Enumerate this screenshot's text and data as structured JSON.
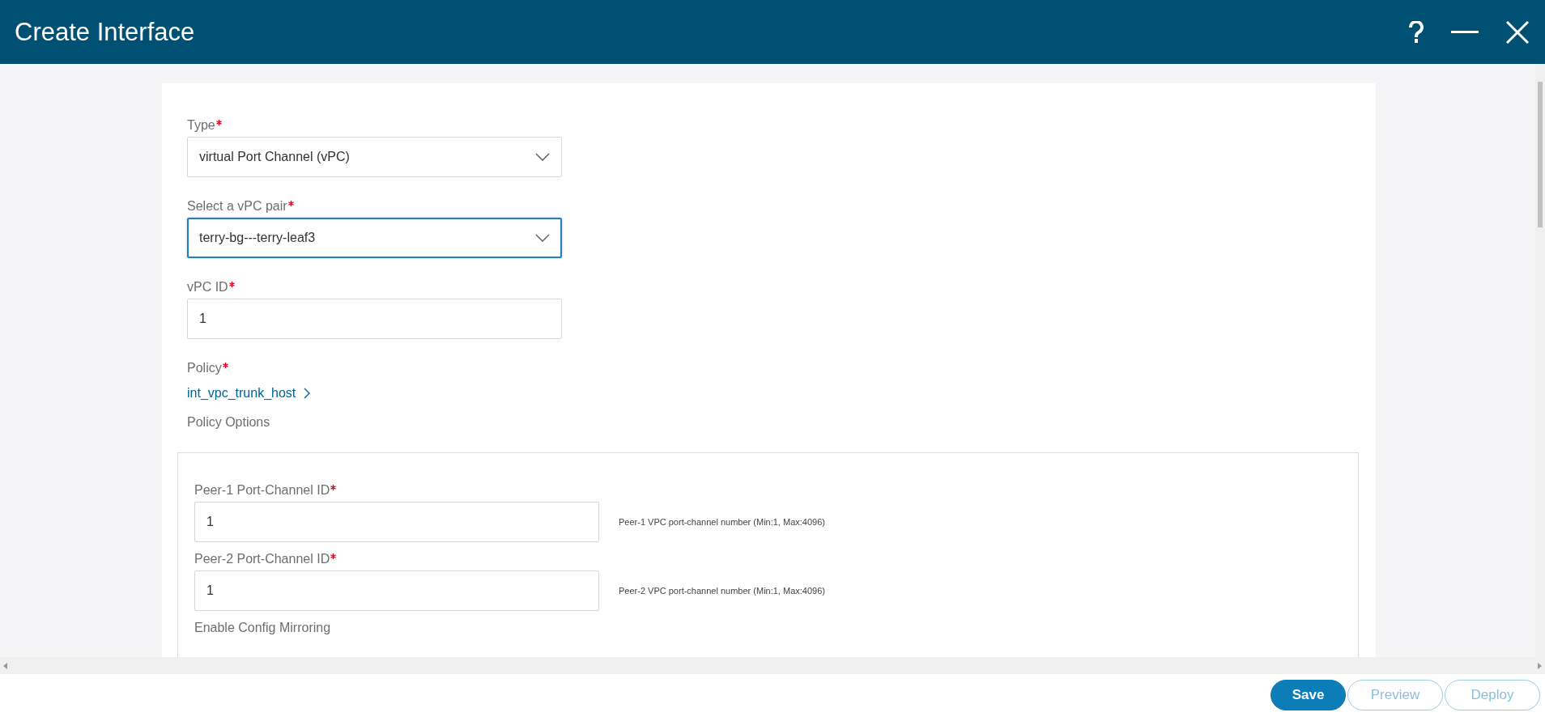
{
  "window": {
    "title": "Create Interface"
  },
  "form": {
    "fields": [
      {
        "kind": "select",
        "label": "Type",
        "required": true,
        "value": "virtual Port Channel (vPC)",
        "focused": false
      },
      {
        "kind": "select",
        "label": "Select a vPC pair",
        "required": true,
        "value": "terry-bg---terry-leaf3",
        "focused": true
      },
      {
        "kind": "input",
        "label": "vPC ID",
        "required": true,
        "value": "1",
        "focused": false
      },
      {
        "kind": "link",
        "label": "Policy",
        "required": true,
        "value": "int_vpc_trunk_host"
      }
    ],
    "section_title": "Policy Options"
  },
  "policy_options": {
    "fields": [
      {
        "kind": "input",
        "label": "Peer-1 Port-Channel ID",
        "required": true,
        "value": "1",
        "help": "Peer-1 VPC port-channel number (Min:1, Max:4096)"
      },
      {
        "kind": "input",
        "label": "Peer-2 Port-Channel ID",
        "required": true,
        "value": "1",
        "help": "Peer-2 VPC port-channel number (Min:1, Max:4096)"
      },
      {
        "kind": "heading",
        "label": "Enable Config Mirroring",
        "required": false
      }
    ]
  },
  "buttons": [
    {
      "label": "Save",
      "kind": "primary",
      "disabled": false
    },
    {
      "label": "Preview",
      "kind": "outline",
      "disabled": true
    },
    {
      "label": "Deploy",
      "kind": "outline",
      "disabled": true
    }
  ]
}
